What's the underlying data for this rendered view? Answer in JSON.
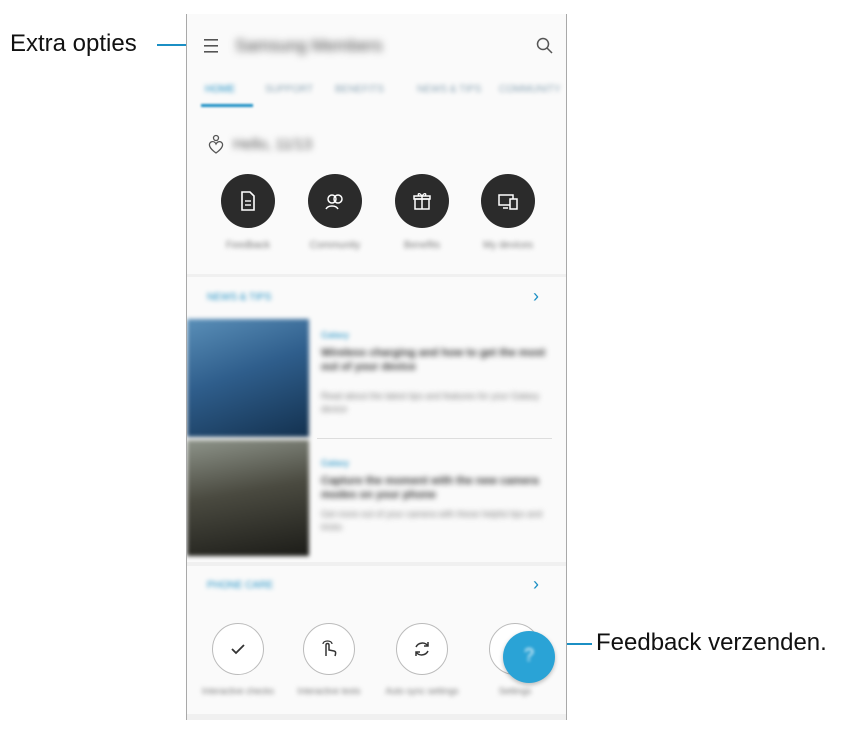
{
  "annotations": {
    "more_options": "Extra opties",
    "send_feedback": "Feedback verzenden."
  },
  "app": {
    "title": "Samsung Members",
    "menu_icon": "menu-icon",
    "search_icon": "search-icon"
  },
  "tabs": [
    {
      "label": "HOME",
      "active": true
    },
    {
      "label": "SUPPORT",
      "active": false
    },
    {
      "label": "BENEFITS",
      "active": false
    },
    {
      "label": "NEWS & TIPS",
      "active": false
    },
    {
      "label": "COMMUNITY",
      "active": false
    }
  ],
  "greeting": {
    "icon": "hello-heart-icon",
    "text": "Hello, 11/13"
  },
  "quick_actions": [
    {
      "label": "Feedback",
      "icon": "document-icon"
    },
    {
      "label": "Community",
      "icon": "people-icon"
    },
    {
      "label": "Benefits",
      "icon": "gift-icon"
    },
    {
      "label": "My devices",
      "icon": "devices-icon"
    }
  ],
  "news_section": {
    "title": "NEWS & TIPS",
    "chevron": "chevron-right-icon",
    "articles": [
      {
        "category": "Galaxy",
        "title": "Wireless charging and how to get the most out of your device",
        "desc": "Read about the latest tips and features for your Galaxy device"
      },
      {
        "category": "Galaxy",
        "title": "Capture the moment with the new camera modes on your phone",
        "desc": "Get more out of your camera with these helpful tips and tricks"
      }
    ]
  },
  "diagnostics_section": {
    "title": "PHONE CARE",
    "chevron": "chevron-right-icon",
    "items": [
      {
        "label": "Interactive checks",
        "icon": "check-icon"
      },
      {
        "label": "Interactive tests",
        "icon": "touch-icon"
      },
      {
        "label": "Auto sync settings",
        "icon": "sync-icon"
      },
      {
        "label": "Settings",
        "icon": "gear-icon"
      }
    ]
  },
  "fab": {
    "label": "?",
    "icon": "feedback-fab-icon"
  },
  "colors": {
    "accent": "#1b8fc4",
    "fab": "#2aa3d6",
    "dark_button": "#2b2b2b"
  }
}
